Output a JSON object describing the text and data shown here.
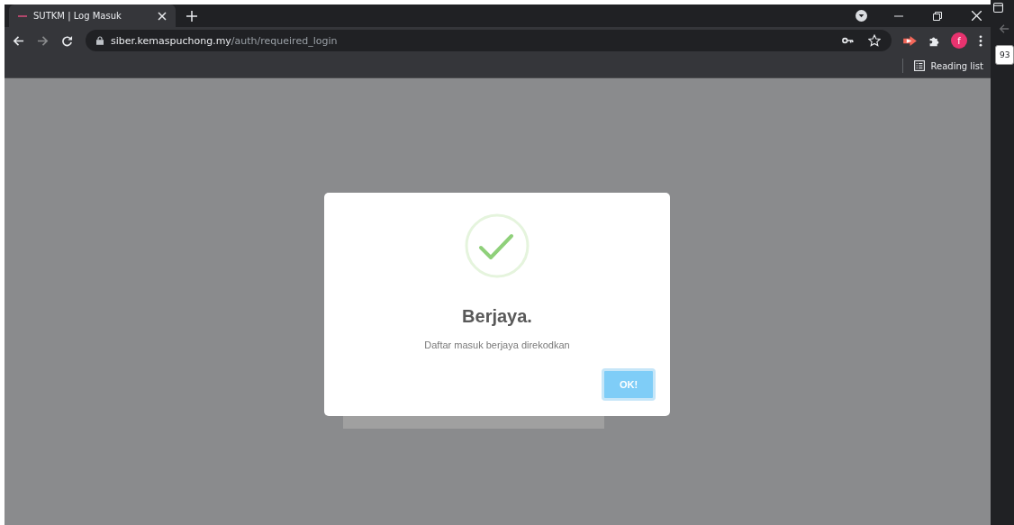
{
  "browser": {
    "tabs": [
      {
        "title": "SUTKM | Log Masuk",
        "selected": true
      }
    ],
    "address": {
      "domain": "siber.kemaspuchong.my",
      "path": "/auth/requeired_login"
    },
    "profile_initial": "f",
    "reading_list": "Reading list"
  },
  "side_window": {
    "field_value": "93"
  },
  "dialog": {
    "kind": "success",
    "title": "Berjaya.",
    "message": "Daftar masuk berjaya direkodkan",
    "button": "OK!"
  }
}
